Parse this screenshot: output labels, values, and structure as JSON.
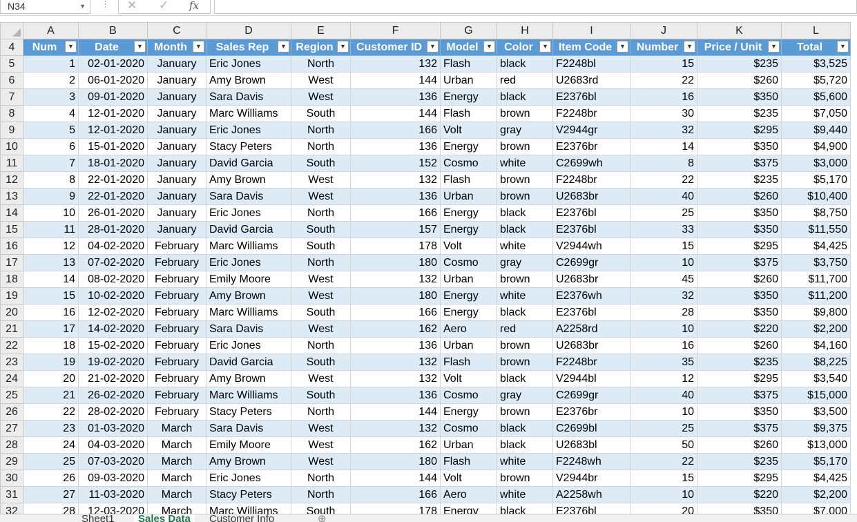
{
  "name_box": "N34",
  "formula_buttons": {
    "cancel": "✕",
    "enter": "✓",
    "fx": "fx"
  },
  "column_letters": [
    "A",
    "B",
    "C",
    "D",
    "E",
    "F",
    "G",
    "H",
    "I",
    "J",
    "K",
    "L"
  ],
  "header_row_number": "4",
  "headers": [
    "Num",
    "Date",
    "Month",
    "Sales Rep",
    "Region",
    "Customer ID",
    "Model",
    "Color",
    "Item Code",
    "Number",
    "Price / Unit",
    "Total"
  ],
  "rows": [
    {
      "row": "5",
      "num": "1",
      "date": "02-01-2020",
      "month": "January",
      "rep": "Eric Jones",
      "region": "North",
      "cust": "132",
      "model": "Flash",
      "color": "black",
      "code": "F2248bl",
      "qty": "15",
      "price": "$235",
      "total": "$3,525"
    },
    {
      "row": "6",
      "num": "2",
      "date": "06-01-2020",
      "month": "January",
      "rep": "Amy Brown",
      "region": "West",
      "cust": "144",
      "model": "Urban",
      "color": "red",
      "code": "U2683rd",
      "qty": "22",
      "price": "$260",
      "total": "$5,720"
    },
    {
      "row": "7",
      "num": "3",
      "date": "09-01-2020",
      "month": "January",
      "rep": "Sara Davis",
      "region": "West",
      "cust": "136",
      "model": "Energy",
      "color": "black",
      "code": "E2376bl",
      "qty": "16",
      "price": "$350",
      "total": "$5,600"
    },
    {
      "row": "8",
      "num": "4",
      "date": "12-01-2020",
      "month": "January",
      "rep": "Marc Williams",
      "region": "South",
      "cust": "144",
      "model": "Flash",
      "color": "brown",
      "code": "F2248br",
      "qty": "30",
      "price": "$235",
      "total": "$7,050"
    },
    {
      "row": "9",
      "num": "5",
      "date": "12-01-2020",
      "month": "January",
      "rep": "Eric Jones",
      "region": "North",
      "cust": "166",
      "model": "Volt",
      "color": "gray",
      "code": "V2944gr",
      "qty": "32",
      "price": "$295",
      "total": "$9,440"
    },
    {
      "row": "10",
      "num": "6",
      "date": "15-01-2020",
      "month": "January",
      "rep": "Stacy Peters",
      "region": "North",
      "cust": "136",
      "model": "Energy",
      "color": "brown",
      "code": "E2376br",
      "qty": "14",
      "price": "$350",
      "total": "$4,900"
    },
    {
      "row": "11",
      "num": "7",
      "date": "18-01-2020",
      "month": "January",
      "rep": "David Garcia",
      "region": "South",
      "cust": "152",
      "model": "Cosmo",
      "color": "white",
      "code": "C2699wh",
      "qty": "8",
      "price": "$375",
      "total": "$3,000"
    },
    {
      "row": "12",
      "num": "8",
      "date": "22-01-2020",
      "month": "January",
      "rep": "Amy Brown",
      "region": "West",
      "cust": "132",
      "model": "Flash",
      "color": "brown",
      "code": "F2248br",
      "qty": "22",
      "price": "$235",
      "total": "$5,170"
    },
    {
      "row": "13",
      "num": "9",
      "date": "22-01-2020",
      "month": "January",
      "rep": "Sara Davis",
      "region": "West",
      "cust": "136",
      "model": "Urban",
      "color": "brown",
      "code": "U2683br",
      "qty": "40",
      "price": "$260",
      "total": "$10,400"
    },
    {
      "row": "14",
      "num": "10",
      "date": "26-01-2020",
      "month": "January",
      "rep": "Eric Jones",
      "region": "North",
      "cust": "166",
      "model": "Energy",
      "color": "black",
      "code": "E2376bl",
      "qty": "25",
      "price": "$350",
      "total": "$8,750"
    },
    {
      "row": "15",
      "num": "11",
      "date": "28-01-2020",
      "month": "January",
      "rep": "David Garcia",
      "region": "South",
      "cust": "157",
      "model": "Energy",
      "color": "black",
      "code": "E2376bl",
      "qty": "33",
      "price": "$350",
      "total": "$11,550"
    },
    {
      "row": "16",
      "num": "12",
      "date": "04-02-2020",
      "month": "February",
      "rep": "Marc Williams",
      "region": "South",
      "cust": "178",
      "model": "Volt",
      "color": "white",
      "code": "V2944wh",
      "qty": "15",
      "price": "$295",
      "total": "$4,425"
    },
    {
      "row": "17",
      "num": "13",
      "date": "07-02-2020",
      "month": "February",
      "rep": "Eric Jones",
      "region": "North",
      "cust": "180",
      "model": "Cosmo",
      "color": "gray",
      "code": "C2699gr",
      "qty": "10",
      "price": "$375",
      "total": "$3,750"
    },
    {
      "row": "18",
      "num": "14",
      "date": "08-02-2020",
      "month": "February",
      "rep": "Emily Moore",
      "region": "West",
      "cust": "132",
      "model": "Urban",
      "color": "brown",
      "code": "U2683br",
      "qty": "45",
      "price": "$260",
      "total": "$11,700"
    },
    {
      "row": "19",
      "num": "15",
      "date": "10-02-2020",
      "month": "February",
      "rep": "Amy Brown",
      "region": "West",
      "cust": "180",
      "model": "Energy",
      "color": "white",
      "code": "E2376wh",
      "qty": "32",
      "price": "$350",
      "total": "$11,200"
    },
    {
      "row": "20",
      "num": "16",
      "date": "12-02-2020",
      "month": "February",
      "rep": "Marc Williams",
      "region": "South",
      "cust": "166",
      "model": "Energy",
      "color": "black",
      "code": "E2376bl",
      "qty": "28",
      "price": "$350",
      "total": "$9,800"
    },
    {
      "row": "21",
      "num": "17",
      "date": "14-02-2020",
      "month": "February",
      "rep": "Sara Davis",
      "region": "West",
      "cust": "162",
      "model": "Aero",
      "color": "red",
      "code": "A2258rd",
      "qty": "10",
      "price": "$220",
      "total": "$2,200"
    },
    {
      "row": "22",
      "num": "18",
      "date": "15-02-2020",
      "month": "February",
      "rep": "Eric Jones",
      "region": "North",
      "cust": "136",
      "model": "Urban",
      "color": "brown",
      "code": "U2683br",
      "qty": "16",
      "price": "$260",
      "total": "$4,160"
    },
    {
      "row": "23",
      "num": "19",
      "date": "19-02-2020",
      "month": "February",
      "rep": "David Garcia",
      "region": "South",
      "cust": "132",
      "model": "Flash",
      "color": "brown",
      "code": "F2248br",
      "qty": "35",
      "price": "$235",
      "total": "$8,225"
    },
    {
      "row": "24",
      "num": "20",
      "date": "21-02-2020",
      "month": "February",
      "rep": "Amy Brown",
      "region": "West",
      "cust": "132",
      "model": "Volt",
      "color": "black",
      "code": "V2944bl",
      "qty": "12",
      "price": "$295",
      "total": "$3,540"
    },
    {
      "row": "25",
      "num": "21",
      "date": "26-02-2020",
      "month": "February",
      "rep": "Marc Williams",
      "region": "South",
      "cust": "136",
      "model": "Cosmo",
      "color": "gray",
      "code": "C2699gr",
      "qty": "40",
      "price": "$375",
      "total": "$15,000"
    },
    {
      "row": "26",
      "num": "22",
      "date": "28-02-2020",
      "month": "February",
      "rep": "Stacy Peters",
      "region": "North",
      "cust": "144",
      "model": "Energy",
      "color": "brown",
      "code": "E2376br",
      "qty": "10",
      "price": "$350",
      "total": "$3,500"
    },
    {
      "row": "27",
      "num": "23",
      "date": "01-03-2020",
      "month": "March",
      "rep": "Sara Davis",
      "region": "West",
      "cust": "132",
      "model": "Cosmo",
      "color": "black",
      "code": "C2699bl",
      "qty": "25",
      "price": "$375",
      "total": "$9,375"
    },
    {
      "row": "28",
      "num": "24",
      "date": "04-03-2020",
      "month": "March",
      "rep": "Emily Moore",
      "region": "West",
      "cust": "162",
      "model": "Urban",
      "color": "black",
      "code": "U2683bl",
      "qty": "50",
      "price": "$260",
      "total": "$13,000"
    },
    {
      "row": "29",
      "num": "25",
      "date": "07-03-2020",
      "month": "March",
      "rep": "Amy Brown",
      "region": "West",
      "cust": "180",
      "model": "Flash",
      "color": "white",
      "code": "F2248wh",
      "qty": "22",
      "price": "$235",
      "total": "$5,170"
    },
    {
      "row": "30",
      "num": "26",
      "date": "09-03-2020",
      "month": "March",
      "rep": "Eric Jones",
      "region": "North",
      "cust": "144",
      "model": "Volt",
      "color": "brown",
      "code": "V2944br",
      "qty": "15",
      "price": "$295",
      "total": "$4,425"
    },
    {
      "row": "31",
      "num": "27",
      "date": "11-03-2020",
      "month": "March",
      "rep": "Stacy Peters",
      "region": "North",
      "cust": "166",
      "model": "Aero",
      "color": "white",
      "code": "A2258wh",
      "qty": "10",
      "price": "$220",
      "total": "$2,200"
    },
    {
      "row": "32",
      "num": "28",
      "date": "12-03-2020",
      "month": "March",
      "rep": "Marc Williams",
      "region": "South",
      "cust": "178",
      "model": "Energy",
      "color": "black",
      "code": "E2376bl",
      "qty": "20",
      "price": "$350",
      "total": "$7,000"
    }
  ],
  "sheet_tabs": [
    "Sheet1",
    "Sales Data",
    "Customer Info"
  ],
  "active_tab": "Sales Data",
  "colors": {
    "header_fill": "#5b9bd5",
    "band_fill": "#ddebf7",
    "active_tab": "#217346"
  }
}
